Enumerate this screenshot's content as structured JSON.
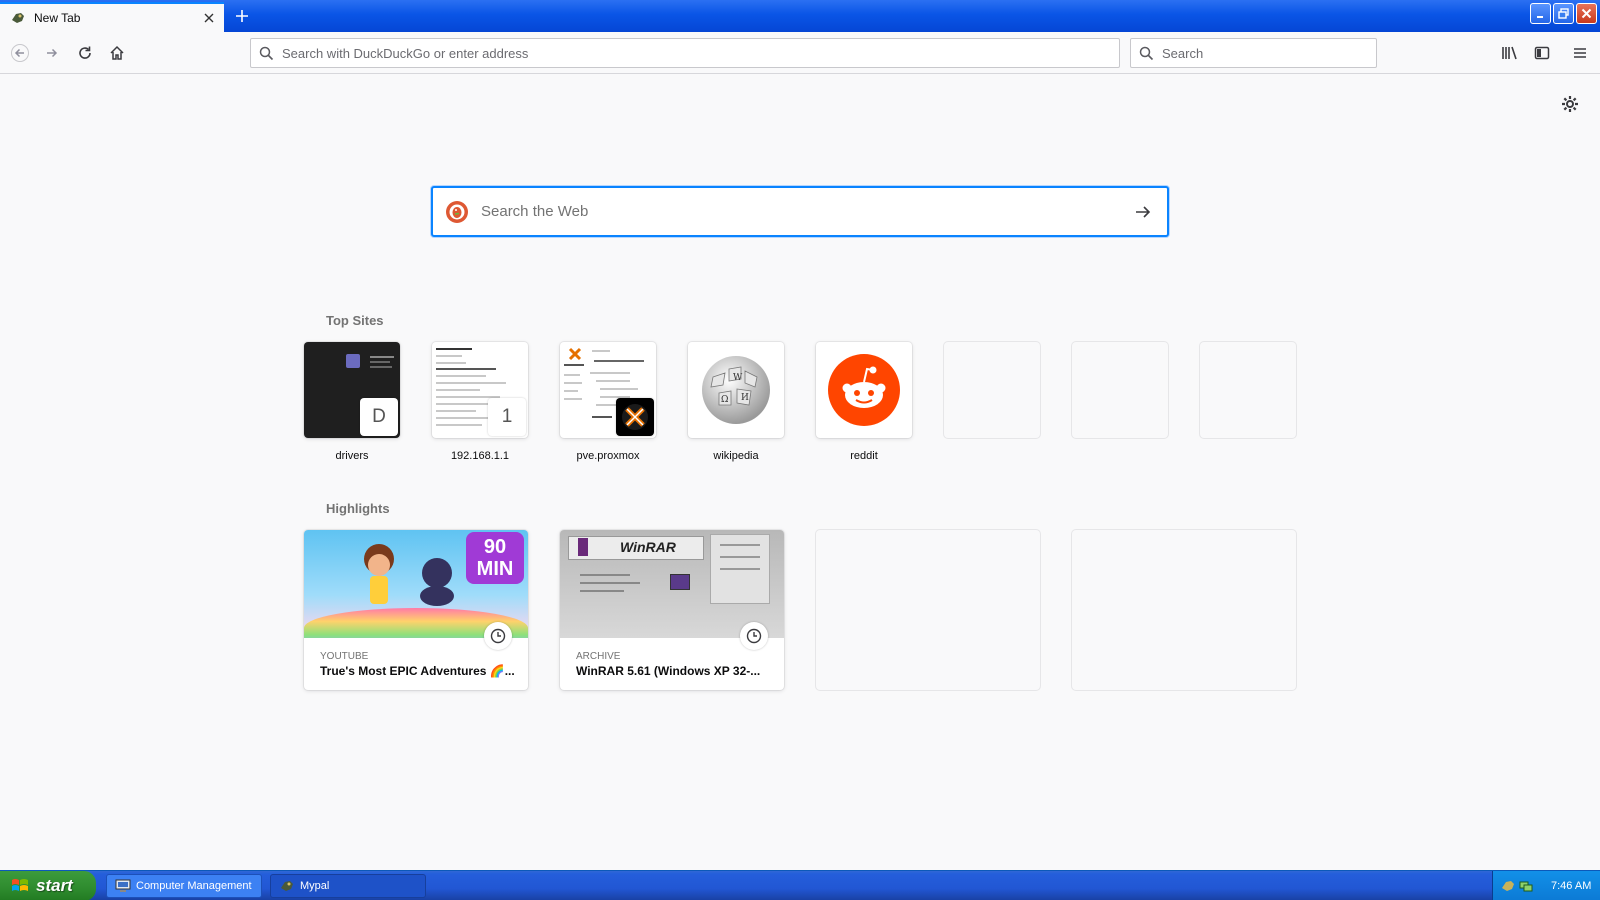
{
  "browser": {
    "tab_title": "New Tab",
    "url_placeholder": "Search with DuckDuckGo or enter address",
    "search_placeholder": "Search"
  },
  "newtab": {
    "web_search_placeholder": "Search the Web",
    "topsites_title": "Top Sites",
    "topsites": [
      {
        "label": "drivers",
        "badge": "D"
      },
      {
        "label": "192.168.1.1",
        "badge": "1"
      },
      {
        "label": "pve.proxmox",
        "badge_icon": "proxmox-icon"
      },
      {
        "label": "wikipedia",
        "icon": "wikipedia-globe-icon"
      },
      {
        "label": "reddit",
        "icon": "reddit-icon"
      },
      {
        "label": ""
      },
      {
        "label": ""
      },
      {
        "label": ""
      }
    ],
    "highlights_title": "Highlights",
    "highlights": [
      {
        "source": "YOUTUBE",
        "title": "True's Most EPIC Adventures 🌈...",
        "thumb_text": "90 MIN"
      },
      {
        "source": "ARCHIVE",
        "title": "WinRAR 5.61 (Windows XP 32-...",
        "thumb_text": "WinRAR"
      }
    ]
  },
  "taskbar": {
    "start_label": "start",
    "tasks": [
      {
        "label": "Computer Management",
        "icon": "computer-management-icon"
      },
      {
        "label": "Mypal",
        "icon": "mypal-icon"
      }
    ],
    "clock": "7:46 AM"
  },
  "colors": {
    "accent": "#0a84ff",
    "titlebar_blue": "#0a55e6",
    "reddit_orange": "#ff4500",
    "start_green": "#2e8b2e"
  }
}
